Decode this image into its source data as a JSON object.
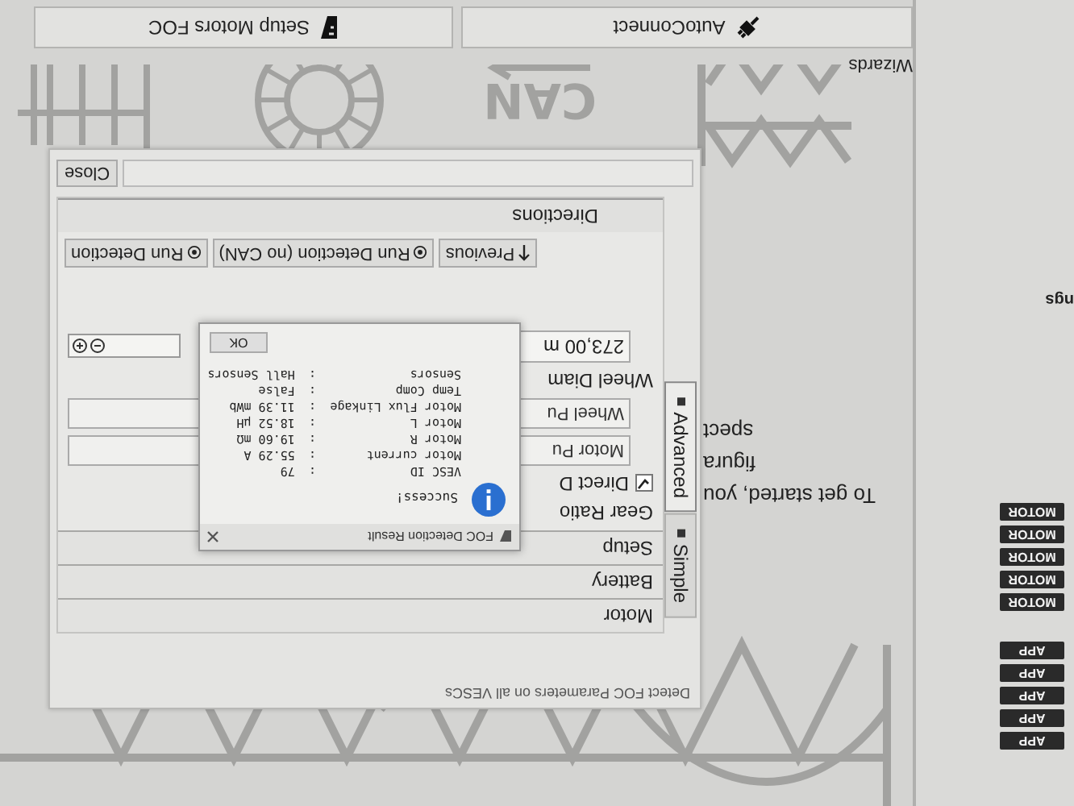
{
  "sidebar": {
    "app_badges": [
      "APP",
      "APP",
      "APP",
      "APP",
      "APP"
    ],
    "motor_badges": [
      "MOTOR",
      "MOTOR",
      "MOTOR",
      "MOTOR",
      "MOTOR"
    ],
    "cut_label": "ngs"
  },
  "background": {
    "can_logo": "CAN"
  },
  "intro_fragments": [
    "To get started, you",
    "figura",
    "spect"
  ],
  "wizards": {
    "title": "Wizards",
    "buttons": [
      {
        "label": "AutoConnect",
        "kind": "plug"
      },
      {
        "label": "Setup Motors FOC",
        "kind": "wizard"
      }
    ]
  },
  "detect_dialog": {
    "title": "Detect FOC Parameters on all VESCs",
    "tabs": [
      {
        "label": "Simple",
        "selected": false
      },
      {
        "label": "Advanced",
        "selected": true
      }
    ],
    "sections": [
      "Motor",
      "Battery",
      "Setup"
    ],
    "gear_ratio": {
      "title": "Gear Ratio",
      "direct_drive": {
        "label": "Direct D",
        "checked": true
      },
      "motor_pulley": "Motor Pu",
      "wheel_pulley": "Wheel Pu"
    },
    "wheel_diameter": {
      "label": "Wheel Diam",
      "value": "273,00 m"
    },
    "actions": [
      {
        "label": "Previous",
        "kind": "previous"
      },
      {
        "label": "Run Detection (no CAN)",
        "kind": "run"
      },
      {
        "label": "Run Detection",
        "kind": "run"
      }
    ],
    "directions": "Directions",
    "close": "Close"
  },
  "result_dialog": {
    "title": "FOC Detection Result",
    "status": "Success!",
    "lines": [
      {
        "label": "VESC ID",
        "separator": ":",
        "value": "79"
      },
      {
        "label": "Motor current",
        "separator": ":",
        "value": "55.29 A"
      },
      {
        "label": "Motor R",
        "separator": ":",
        "value": "19.60 mΩ"
      },
      {
        "label": "Motor L",
        "separator": ":",
        "value": "18.52 µH"
      },
      {
        "label": "Motor Flux Linkage",
        "separator": ":",
        "value": "11.39 mWb"
      },
      {
        "label": "Temp Comp",
        "separator": ":",
        "value": "False"
      },
      {
        "label": "Sensors",
        "separator": ":",
        "value": "Hall Sensors"
      }
    ],
    "ok": "OK"
  }
}
